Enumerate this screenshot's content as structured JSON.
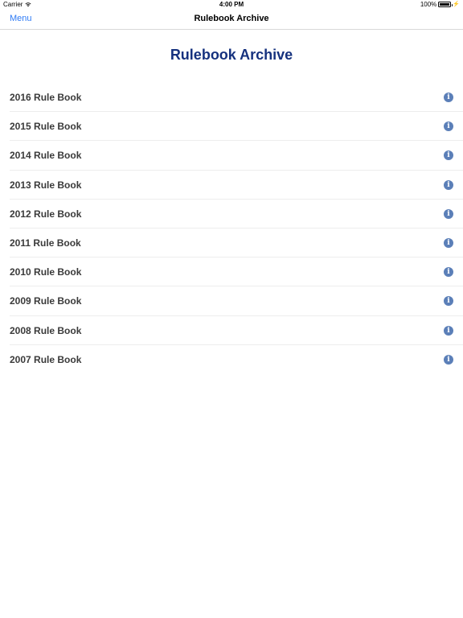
{
  "status_bar": {
    "carrier": "Carrier",
    "wifi_icon": "wifi-icon",
    "time": "4:00 PM",
    "battery": "100%",
    "battery_icon": "battery-icon",
    "charge_icon": "charging-bolt-icon"
  },
  "nav": {
    "back_label": "Menu",
    "title": "Rulebook Archive",
    "accent_color": "#2f7bf5"
  },
  "page": {
    "title": "Rulebook Archive",
    "title_color": "#15317e"
  },
  "list": {
    "info_icon": "info-icon",
    "info_icon_color": "#5b7fb8",
    "items": [
      {
        "label": "2016 Rule Book"
      },
      {
        "label": "2015 Rule Book"
      },
      {
        "label": "2014 Rule Book"
      },
      {
        "label": "2013 Rule Book"
      },
      {
        "label": "2012 Rule Book"
      },
      {
        "label": "2011 Rule Book"
      },
      {
        "label": "2010 Rule Book"
      },
      {
        "label": "2009 Rule Book"
      },
      {
        "label": "2008 Rule Book"
      },
      {
        "label": "2007 Rule Book"
      }
    ]
  }
}
